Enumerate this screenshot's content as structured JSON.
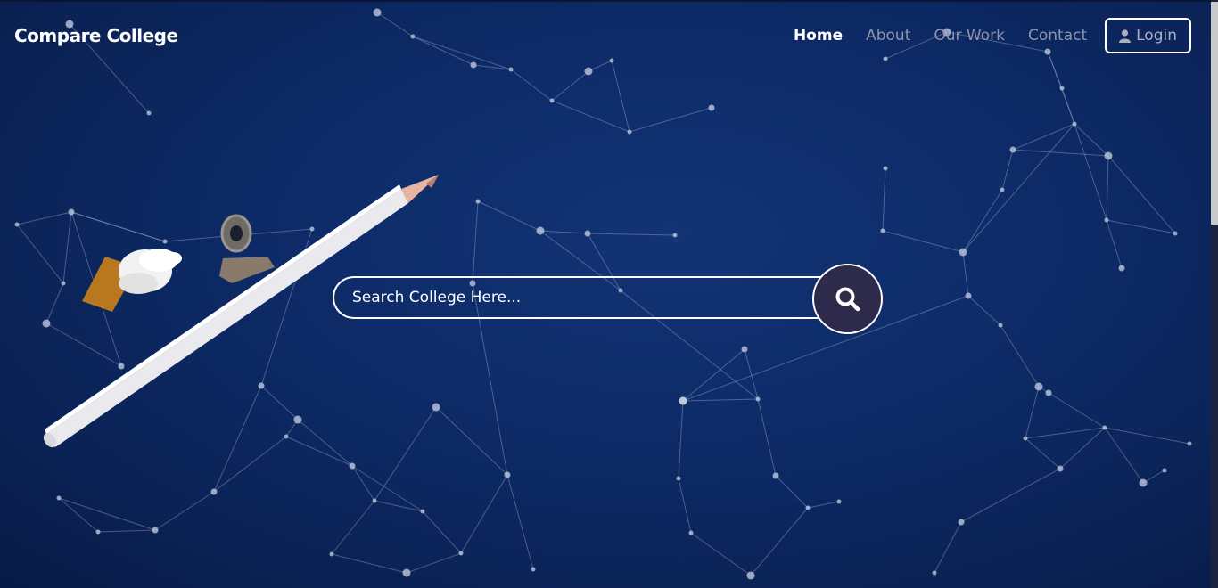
{
  "brand": {
    "name": "Compare College"
  },
  "nav": {
    "items": [
      {
        "label": "Home",
        "active": true
      },
      {
        "label": "About",
        "active": false
      },
      {
        "label": "Our Work",
        "active": false
      },
      {
        "label": "Contact",
        "active": false
      }
    ],
    "login_label": "Login",
    "login_icon": "user-icon"
  },
  "search": {
    "placeholder": "Search College Here...",
    "value": "",
    "button_icon": "search-icon"
  },
  "colors": {
    "background": "#0d2a66",
    "search_button": "#2e2a4c",
    "nav_inactive": "#8e95a8",
    "nav_active": "#ffffff"
  }
}
